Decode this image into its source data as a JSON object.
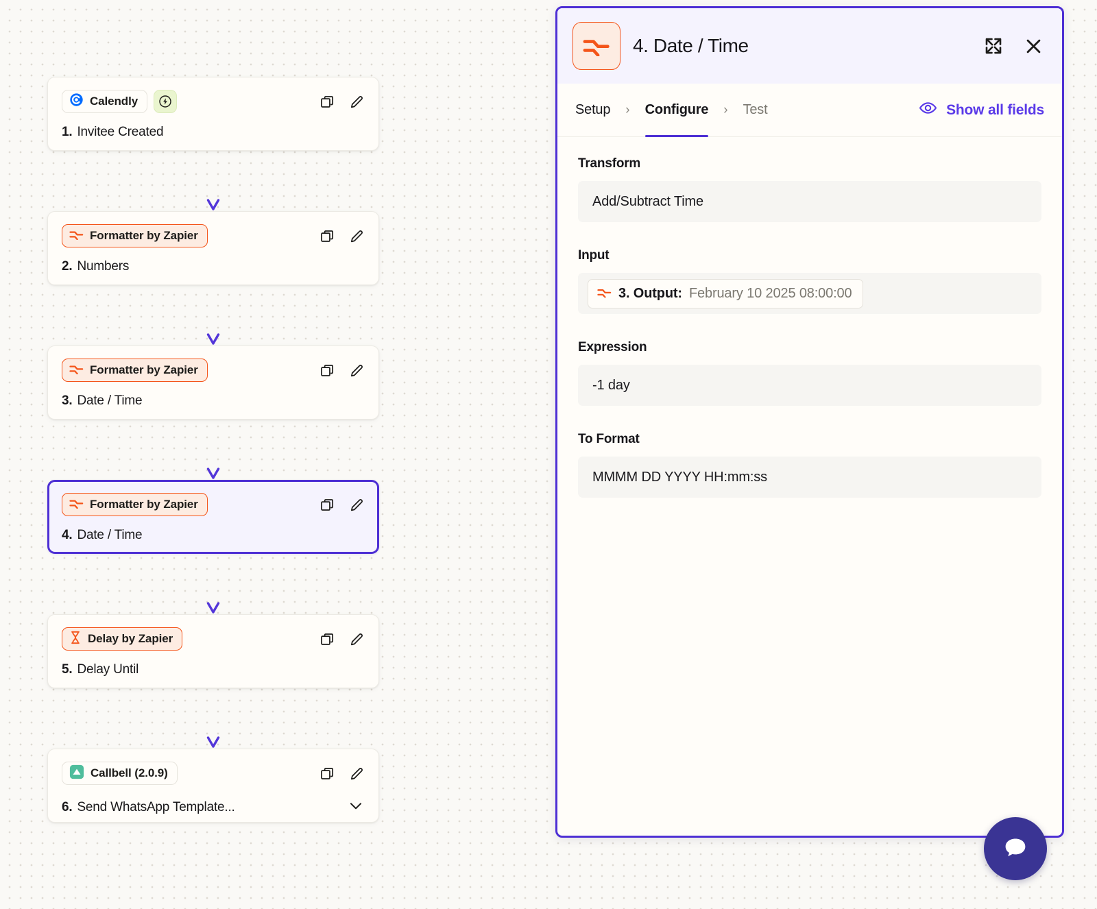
{
  "canvas": {
    "nodes": [
      {
        "app": "Calendly",
        "app_icon": "calendly-icon",
        "chip_style": "neutral",
        "badge": "lightning-bolt-badge",
        "step_number": "1.",
        "step_title": "Invitee Created",
        "selected": false,
        "has_chevron": false,
        "actions": [
          "duplicate-icon",
          "edit-icon"
        ]
      },
      {
        "app": "Formatter by Zapier",
        "app_icon": "formatter-icon",
        "chip_style": "orange",
        "badge": null,
        "step_number": "2.",
        "step_title": "Numbers",
        "selected": false,
        "has_chevron": false,
        "actions": [
          "duplicate-icon",
          "edit-icon"
        ]
      },
      {
        "app": "Formatter by Zapier",
        "app_icon": "formatter-icon",
        "chip_style": "orange",
        "badge": null,
        "step_number": "3.",
        "step_title": "Date / Time",
        "selected": false,
        "has_chevron": false,
        "actions": [
          "duplicate-icon",
          "edit-icon"
        ]
      },
      {
        "app": "Formatter by Zapier",
        "app_icon": "formatter-icon",
        "chip_style": "orange",
        "badge": null,
        "step_number": "4.",
        "step_title": "Date / Time",
        "selected": true,
        "has_chevron": false,
        "actions": [
          "duplicate-icon",
          "edit-icon"
        ]
      },
      {
        "app": "Delay by Zapier",
        "app_icon": "hourglass-icon",
        "chip_style": "orange",
        "badge": null,
        "step_number": "5.",
        "step_title": "Delay Until",
        "selected": false,
        "has_chevron": false,
        "actions": [
          "duplicate-icon",
          "edit-icon"
        ]
      },
      {
        "app": "Callbell (2.0.9)",
        "app_icon": "callbell-icon",
        "chip_style": "teal",
        "badge": null,
        "step_number": "6.",
        "step_title": "Send WhatsApp Template...",
        "selected": false,
        "has_chevron": true,
        "actions": [
          "duplicate-icon",
          "edit-icon"
        ]
      }
    ]
  },
  "panel": {
    "app_icon": "formatter-icon",
    "title": "4. Date / Time",
    "expand_icon": "expand-icon",
    "close_icon": "close-icon",
    "tabs": [
      {
        "label": "Setup",
        "active": false,
        "muted": false
      },
      {
        "label": "Configure",
        "active": true,
        "muted": false
      },
      {
        "label": "Test",
        "active": false,
        "muted": true
      }
    ],
    "tab_separator": "›",
    "show_all_fields": {
      "label": "Show all fields",
      "icon": "eye-icon"
    },
    "fields": [
      {
        "label": "Transform",
        "type": "text",
        "value": "Add/Subtract Time"
      },
      {
        "label": "Input",
        "type": "token",
        "token_icon": "formatter-icon",
        "token_label": "3. Output:",
        "token_value": "February 10 2025 08:00:00"
      },
      {
        "label": "Expression",
        "type": "text",
        "value": "-1 day"
      },
      {
        "label": "To Format",
        "type": "text",
        "value": "MMMM DD YYYY HH:mm:ss"
      }
    ]
  },
  "chat": {
    "icon": "chat-bubble-icon"
  },
  "colors": {
    "accent_purple": "#4d2fd4",
    "link_purple": "#5a3ae8",
    "formatter_orange": "#f4551a",
    "canvas_bg": "#faf9f6",
    "panel_header_bg": "#f5f3fe",
    "selected_node_bg": "#f5f3fe",
    "chat_bubble": "#3a3494",
    "calendly_blue": "#006bff",
    "callbell_teal": "#4fbd9c",
    "badge_green": "#eaf5cf"
  }
}
